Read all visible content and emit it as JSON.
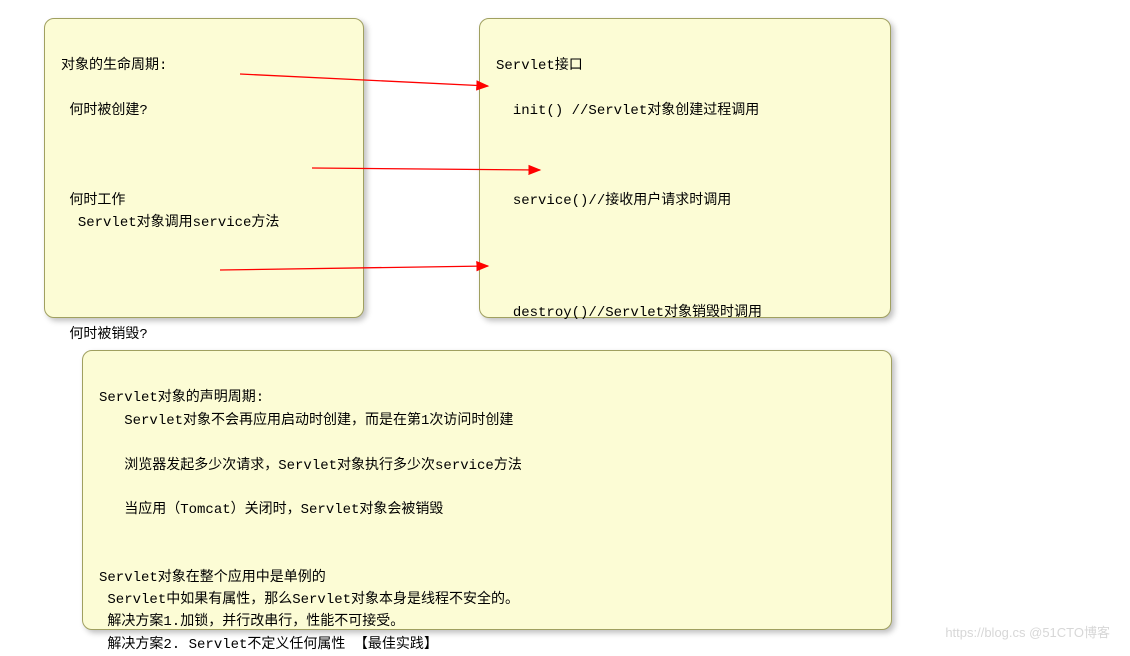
{
  "box1": {
    "title": "对象的生命周期:",
    "q1": "何时被创建?",
    "q2_label": "何时工作",
    "q2_body": "Servlet对象调用service方法",
    "q3": "何时被销毁?"
  },
  "box2": {
    "title": "Servlet接口",
    "line1": "init() //Servlet对象创建过程调用",
    "line2": "service()//接收用户请求时调用",
    "line3": "destroy()//Servlet对象销毁时调用"
  },
  "box3": {
    "header1": "Servlet对象的声明周期:",
    "p1_line1": "Servlet对象不会再应用启动时创建，而是在第1次访问时创建",
    "p1_line2": "浏览器发起多少次请求，Servlet对象执行多少次service方法",
    "p1_line3": "当应用（Tomcat）关闭时，Servlet对象会被销毁",
    "header2": "Servlet对象在整个应用中是单例的",
    "p2_line1": "Servlet中如果有属性，那么Servlet对象本身是线程不安全的。",
    "p2_line2": "解决方案1.加锁，并行改串行，性能不可接受。",
    "p2_line3": "解决方案2. Servlet不定义任何属性 【最佳实践】"
  },
  "arrows": {
    "color": "#ff0000"
  },
  "watermark": "https://blog.cs @51CTO博客"
}
